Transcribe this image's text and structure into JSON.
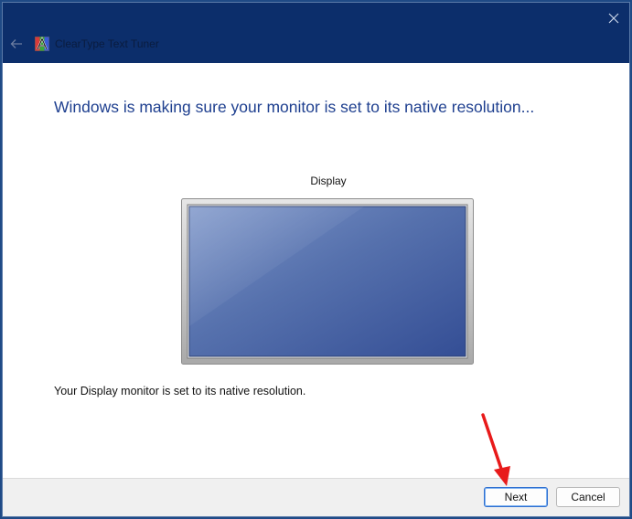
{
  "window": {
    "title": "ClearType Text Tuner"
  },
  "titlebar": {
    "back_icon": "arrow-left-icon",
    "close_icon": "close-icon",
    "app_icon": "cleartype-icon"
  },
  "main": {
    "heading": "Windows is making sure your monitor is set to its native resolution...",
    "display_label": "Display",
    "status_text": "Your Display monitor is set to its native resolution."
  },
  "footer": {
    "next_label": "Next",
    "cancel_label": "Cancel"
  },
  "colors": {
    "titlebar": "#0c2e6b",
    "heading": "#1e3f8f",
    "annotation_arrow": "#e81a1a"
  }
}
